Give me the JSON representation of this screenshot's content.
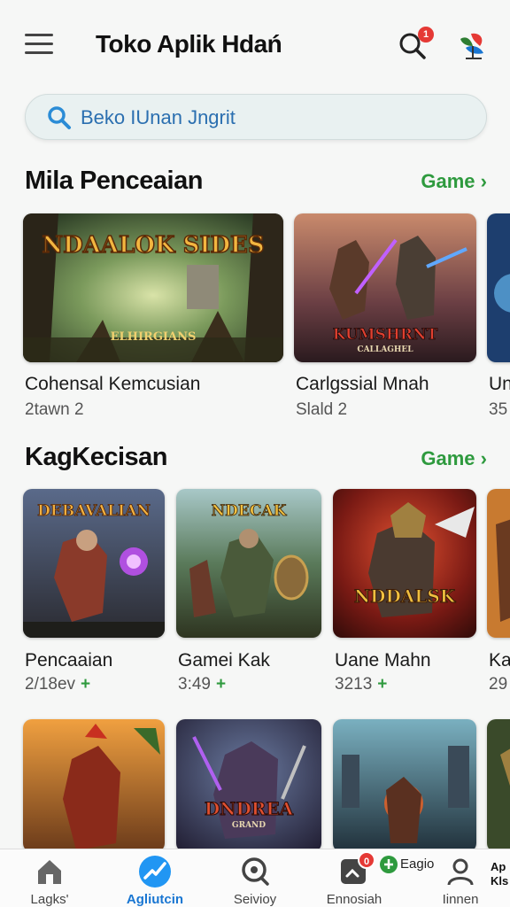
{
  "header": {
    "title": "Toko Aplik Hdań",
    "search_badge": "1"
  },
  "search": {
    "placeholder": "Beko IUnan Jngrit"
  },
  "sections": [
    {
      "title": "Mila Penceaian",
      "link": "Game",
      "cards": [
        {
          "name": "Cohensal Kemcusian",
          "meta": "2tawn 2",
          "art_title": "NDAALOK SIDES",
          "art_subtitle": "ELHIRGIANS"
        },
        {
          "name": "Carlgssial Mnah",
          "meta": "Slald 2",
          "art_title": "KUMSHRNT",
          "art_subtitle": "CALLAGHEL"
        },
        {
          "name": "Un",
          "meta": "35"
        }
      ]
    },
    {
      "title": "KagKecisan",
      "link": "Game",
      "cards": [
        {
          "name": "Pencaaian",
          "meta": "2/18ev",
          "art_title": "DEBAVALIAN"
        },
        {
          "name": "Gamei Kak",
          "meta": "3:49",
          "art_title": "NDECAK"
        },
        {
          "name": "Uane Mahn",
          "meta": "3213",
          "art_title": "NDDALSK"
        },
        {
          "name": "Ka",
          "meta": "29"
        }
      ]
    },
    {
      "cards": [
        {
          "name": ""
        },
        {
          "name": "",
          "art_title": "DNDREA",
          "art_subtitle": "GRAND"
        },
        {
          "name": ""
        },
        {
          "name": ""
        }
      ]
    }
  ],
  "bottom_nav": {
    "items": [
      {
        "label": "Lagks'",
        "icon": "home-icon"
      },
      {
        "label": "Agliutcin",
        "icon": "apps-icon",
        "active": true
      },
      {
        "label": "Seivioy",
        "icon": "search-icon"
      },
      {
        "label": "Ennosiah",
        "icon": "updates-icon",
        "badge": "0"
      },
      {
        "label": "Iinnen",
        "icon": "person-icon"
      }
    ],
    "update_pill": "Eagio",
    "corner_label": "Ap\nKls"
  },
  "colors": {
    "accent": "#1976d2",
    "link_green": "#2e9a3e",
    "badge_red": "#e53935"
  }
}
